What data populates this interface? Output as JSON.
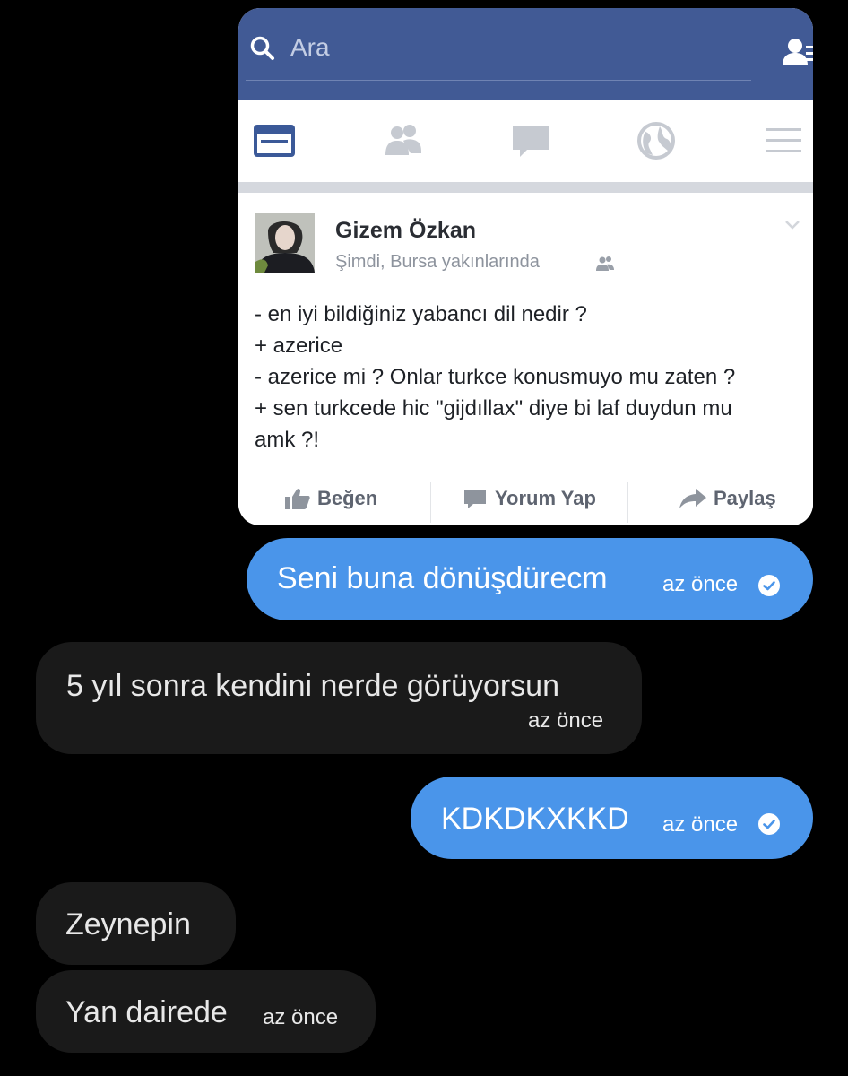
{
  "shared_image": {
    "search_placeholder": "Ara",
    "nav_icons": [
      "news-feed-icon",
      "friends-icon",
      "messages-icon",
      "notifications-globe-icon",
      "menu-icon"
    ],
    "post": {
      "author": "Gizem Özkan",
      "meta": "Şimdi, Bursa yakınlarında",
      "lines": [
        "- en iyi bildiğiniz yabancı dil nedir ?",
        "+ azerice",
        "- azerice mi ? Onlar turkce konusmuyo mu zaten ?",
        "+ sen turkcede hic \"gijdıllax\" diye bi laf duydun mu",
        "amk ?!"
      ],
      "actions": {
        "like": "Beğen",
        "comment": "Yorum Yap",
        "share": "Paylaş"
      }
    },
    "colors": {
      "header": "#415a95",
      "icon_active": "#3b5998",
      "icon_inactive": "#c6cad1"
    }
  },
  "messages": [
    {
      "direction": "outgoing",
      "text": "Seni buna dönüşdürecm",
      "time": "az önce",
      "status_icon": "check-circle-icon"
    },
    {
      "direction": "incoming",
      "text": "5 yıl sonra kendini nerde görüyorsun",
      "time": "az önce"
    },
    {
      "direction": "outgoing",
      "text": "KDKDKXKKD",
      "time": "az önce",
      "status_icon": "check-circle-icon"
    },
    {
      "direction": "incoming",
      "text": "Zeynepin"
    },
    {
      "direction": "incoming",
      "text": "Yan dairede",
      "time": "az önce"
    }
  ],
  "colors": {
    "background": "#000000",
    "outgoing_bubble": "#4a95ea",
    "incoming_bubble": "#1a1a1a"
  }
}
